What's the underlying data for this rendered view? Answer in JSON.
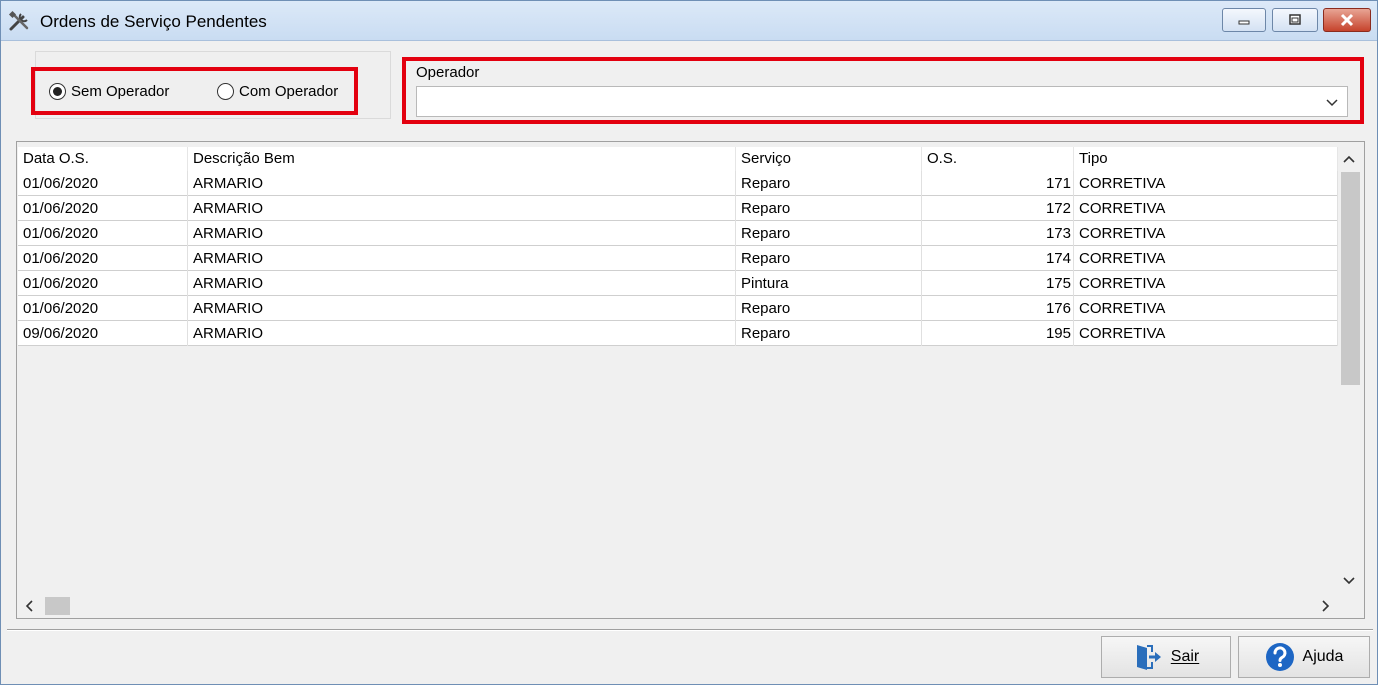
{
  "window": {
    "title": "Ordens de Serviço Pendentes",
    "controls": [
      "minimize-icon",
      "restore-icon",
      "close-icon"
    ]
  },
  "filter": {
    "radio_sem": "Sem Operador",
    "radio_com": "Com Operador",
    "selected": "Sem Operador",
    "operador_label": "Operador",
    "operador_value": ""
  },
  "grid": {
    "columns": [
      "Data O.S.",
      "Descrição Bem",
      "Serviço",
      "O.S.",
      "Tipo"
    ],
    "rows": [
      [
        "01/06/2020",
        "ARMARIO",
        "Reparo",
        "171",
        "CORRETIVA"
      ],
      [
        "01/06/2020",
        "ARMARIO",
        "Reparo",
        "172",
        "CORRETIVA"
      ],
      [
        "01/06/2020",
        "ARMARIO",
        "Reparo",
        "173",
        "CORRETIVA"
      ],
      [
        "01/06/2020",
        "ARMARIO",
        "Reparo",
        "174",
        "CORRETIVA"
      ],
      [
        "01/06/2020",
        "ARMARIO",
        "Pintura",
        "175",
        "CORRETIVA"
      ],
      [
        "01/06/2020",
        "ARMARIO",
        "Reparo",
        "176",
        "CORRETIVA"
      ],
      [
        "09/06/2020",
        "ARMARIO",
        "Reparo",
        "195",
        "CORRETIVA"
      ]
    ]
  },
  "buttons": {
    "sair": "Sair",
    "ajuda": "Ajuda"
  },
  "colors": {
    "highlight": "#e3000f",
    "ajuda_icon": "#1d66c4",
    "sair_icon": "#2a6ebb"
  }
}
